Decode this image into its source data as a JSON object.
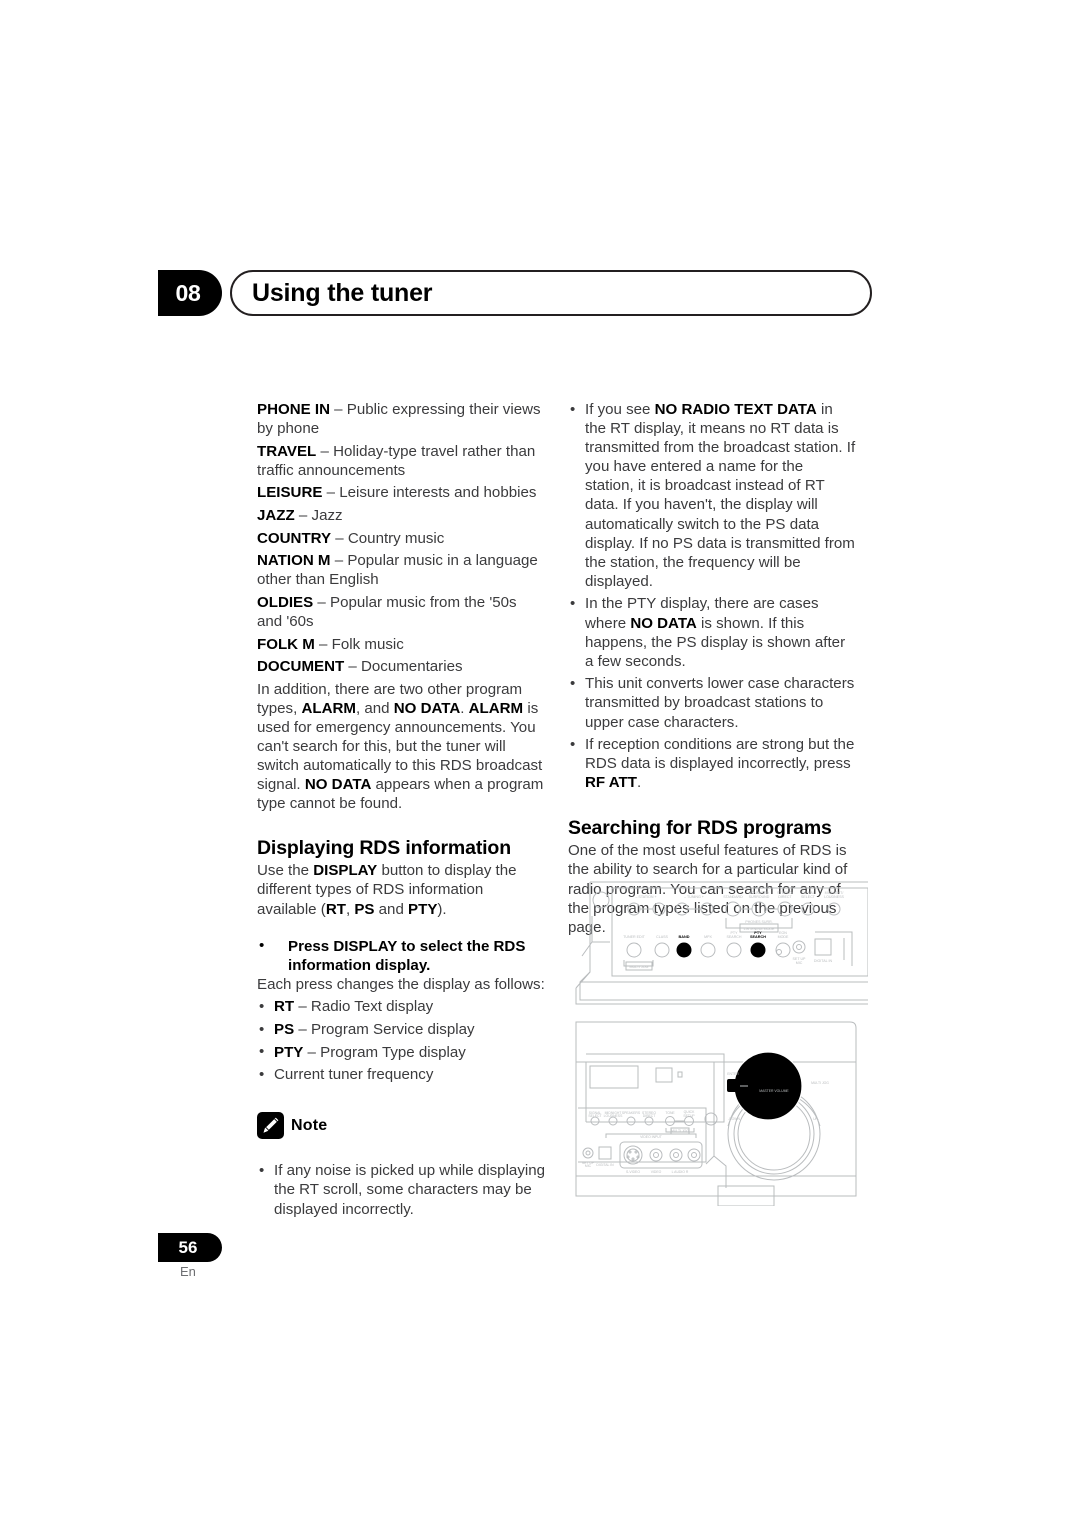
{
  "header": {
    "chapter_number": "08",
    "chapter_title": "Using the tuner"
  },
  "footer": {
    "page_number": "56",
    "language_code": "En"
  },
  "left_column": {
    "program_types": [
      {
        "term": "PHONE IN",
        "dash": " – ",
        "desc": "Public expressing their views by phone"
      },
      {
        "term": "TRAVEL",
        "dash": " – ",
        "desc": "Holiday-type travel rather than traffic announcements"
      },
      {
        "term": "LEISURE",
        "dash": " – ",
        "desc": "Leisure interests and hobbies"
      },
      {
        "term": "JAZZ",
        "dash": " – ",
        "desc": "Jazz"
      },
      {
        "term": "COUNTRY",
        "dash": " – ",
        "desc": "Country music"
      },
      {
        "term": "NATION M",
        "dash": " – ",
        "desc": "Popular music in a language other than English"
      },
      {
        "term": "OLDIES",
        "dash": " – ",
        "desc": "Popular music from the '50s and '60s"
      },
      {
        "term": "FOLK M",
        "dash": " – ",
        "desc": "Folk music"
      },
      {
        "term": "DOCUMENT",
        "dash": " – ",
        "desc": "Documentaries"
      }
    ],
    "addendum": {
      "part1": "In addition, there are two other program types, ",
      "b1": "ALARM",
      "part2": ", and ",
      "b2": "NO DATA",
      "part3": ". ",
      "b3": "ALARM",
      "part4": " is used for emergency announcements. You can't search for this, but the tuner will switch automatically to this RDS broadcast signal. ",
      "b4": "NO DATA",
      "part5": " appears when a program type cannot be found."
    },
    "section_heading": "Displaying RDS information",
    "section_intro": {
      "part1": "Use the ",
      "b1": "DISPLAY",
      "part2": " button to display the different types of RDS information available (",
      "b2": "RT",
      "part3": ", ",
      "b3": "PS",
      "part4": " and ",
      "b4": "PTY",
      "part5": ")."
    },
    "instruction": "Press DISPLAY to select the RDS information display.",
    "instruction_follow": "Each press changes the display as follows:",
    "display_modes": [
      {
        "term": "RT",
        "dash": " – ",
        "desc": "Radio Text display"
      },
      {
        "term": "PS",
        "dash": " – ",
        "desc": "Program Service display"
      },
      {
        "term": "PTY",
        "dash": " – ",
        "desc": "Program Type display"
      },
      {
        "term": "",
        "dash": "",
        "desc": "Current tuner frequency"
      }
    ],
    "note": {
      "icon": "pencil-icon",
      "label": "Note",
      "items": [
        "If any noise is picked up while displaying the RT scroll, some characters may be displayed incorrectly."
      ]
    }
  },
  "right_column": {
    "bullets": [
      {
        "part1": "If you see ",
        "b1": "NO RADIO TEXT DATA",
        "part2": " in the RT display, it means no RT data is transmitted from the broadcast station. If you have entered a name for the station, it is broadcast instead of RT data. If you haven't, the display will automatically switch to the PS data display. If no PS data is transmitted from the station, the frequency will be displayed."
      },
      {
        "part1": "In the PTY display, there are cases where ",
        "b1": "NO DATA",
        "part2": " is shown. If this happens, the PS display is shown after a few seconds."
      },
      {
        "part1": "This unit converts lower case characters transmitted by broadcast stations to upper case characters.",
        "b1": "",
        "part2": ""
      },
      {
        "part1": "If reception conditions are strong but the RDS data is displayed incorrectly, press ",
        "b1": "RF ATT",
        "part2": "."
      }
    ],
    "section_heading": "Searching for RDS programs",
    "section_body": "One of the most useful features of RDS is the ability to search for a particular kind of radio program. You can search for any of the program types listed on the previous page."
  },
  "illustration": {
    "name": "receiver-front-panel-diagram",
    "top_panel_labels": [
      "– STATION +",
      "– TUNING +",
      "STANDARD",
      "ADVANCED SURROUND",
      "STEREO/ DIRECT",
      "SIGNAL SELECT",
      "MIDNIGHT/ LOUDNESS",
      "PHONES SURR.",
      "LISTENING MODE",
      "TUNER EDIT",
      "CLASS",
      "BAND",
      "MPX",
      "PTY SEARCH",
      "EON MODE",
      "MULTI JOG",
      "SET UP MIC",
      "DIGITAL IN"
    ],
    "bottom_panel_labels": [
      "SIGNAL SELECT",
      "MIDNIGHT LOUDNESS",
      "SPEAKERS",
      "STEREO DIRECT",
      "TONE",
      "QUICK SETUP",
      "MULTI JOG",
      "VIDEO INPUT",
      "S-VIDEO",
      "VIDEO",
      "L AUDIO R",
      "SET UP MIC",
      "DIGITAL IN",
      "ENTER",
      "MULTI JOG",
      "MASTER VOLUME"
    ]
  },
  "colors": {
    "text": "#3b3b3d",
    "bold_text": "#000000",
    "rule": "#231f20",
    "diagram_line": "#b9bcbe"
  }
}
